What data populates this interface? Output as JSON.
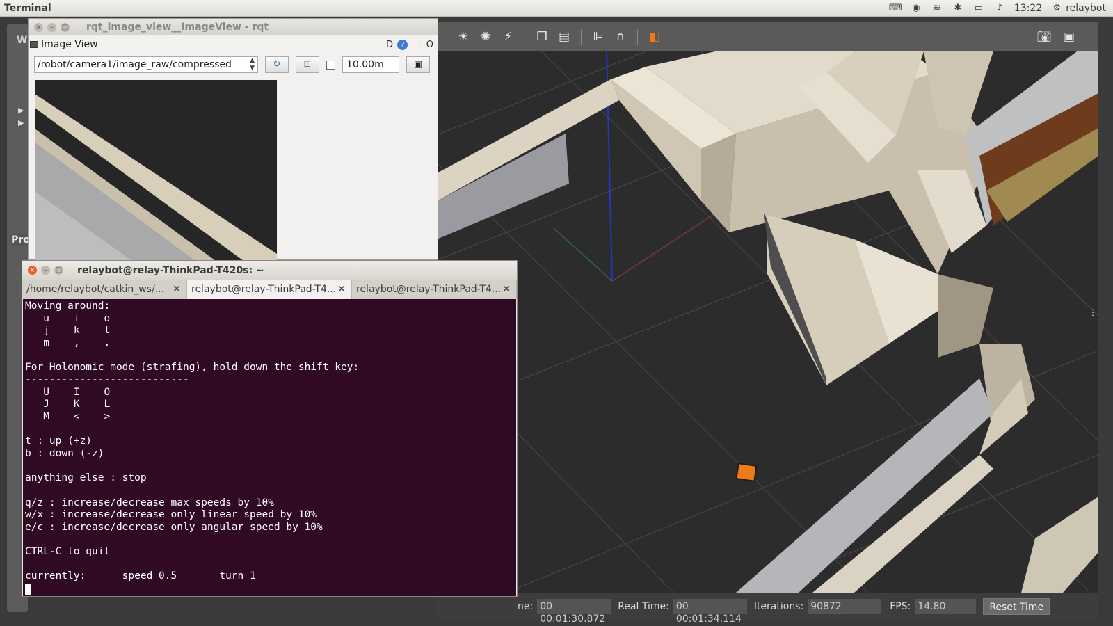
{
  "top_panel": {
    "app_title": "Terminal",
    "clock": "13:22",
    "user": "relaybot"
  },
  "desktop": {
    "left_label": "W",
    "pro_label": "Pro"
  },
  "rqt": {
    "window_title": "rqt_image_view__ImageView - rqt",
    "plugin_title": "Image View",
    "plugin_ctrl_d": "D",
    "plugin_ctrl_help": "?",
    "plugin_ctrl_min": "-",
    "plugin_ctrl_close": "O",
    "topic": "/robot/camera1/image_raw/compressed",
    "range_value": "10.00m"
  },
  "terminal": {
    "window_title": "relaybot@relay-ThinkPad-T420s: ~",
    "tabs": [
      {
        "label": "/home/relaybot/catkin_ws/..."
      },
      {
        "label": "relaybot@relay-ThinkPad-T4..."
      },
      {
        "label": "relaybot@relay-ThinkPad-T4..."
      }
    ],
    "lines": [
      "Moving around:",
      "   u    i    o",
      "   j    k    l",
      "   m    ,    .",
      "",
      "For Holonomic mode (strafing), hold down the shift key:",
      "---------------------------",
      "   U    I    O",
      "   J    K    L",
      "   M    <    >",
      "",
      "t : up (+z)",
      "b : down (-z)",
      "",
      "anything else : stop",
      "",
      "q/z : increase/decrease max speeds by 10%",
      "w/x : increase/decrease only linear speed by 10%",
      "e/c : increase/decrease only angular speed by 10%",
      "",
      "CTRL-C to quit",
      "",
      "currently:      speed 0.5       turn 1"
    ]
  },
  "gazebo": {
    "sim_time_label": "ne:",
    "sim_time": "00 00:01:30.872",
    "real_time_label": "Real Time:",
    "real_time": "00 00:01:34.114",
    "iterations_label": "Iterations:",
    "iterations": "90872",
    "fps_label": "FPS:",
    "fps": "14.80",
    "reset_label": "Reset Time"
  }
}
